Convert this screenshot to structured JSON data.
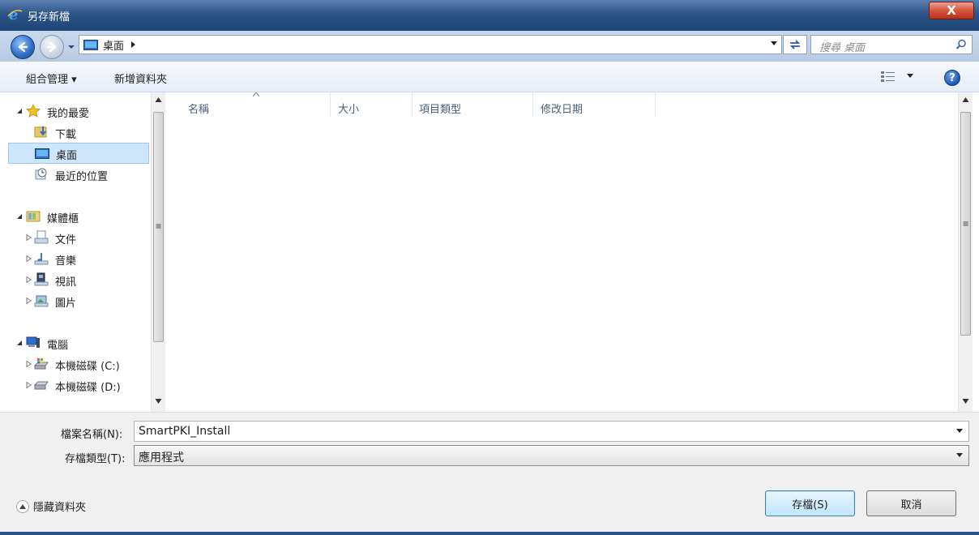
{
  "window": {
    "title": "另存新檔",
    "close_glyph": "X"
  },
  "address": {
    "crumb": "桌面",
    "search_placeholder": "搜尋 桌面"
  },
  "commands": {
    "organize": "組合管理 ▾",
    "new_folder": "新增資料夾",
    "help": "?"
  },
  "nav": {
    "favorites": "我的最愛",
    "downloads": "下載",
    "desktop": "桌面",
    "recent": "最近的位置",
    "libraries": "媒體櫃",
    "documents": "文件",
    "music": "音樂",
    "videos": "視訊",
    "pictures": "圖片",
    "computer": "電腦",
    "drive_c": "本機磁碟 (C:)",
    "drive_d": "本機磁碟 (D:)"
  },
  "columns": {
    "name": "名稱",
    "size": "大小",
    "type": "項目類型",
    "modified": "修改日期"
  },
  "form": {
    "filename_label": "檔案名稱(N):",
    "filename_value": "SmartPKI_Install",
    "filetype_label": "存檔類型(T):",
    "filetype_value": "應用程式",
    "hide_folders": "隱藏資料夾",
    "save": "存檔(S)",
    "cancel": "取消"
  },
  "colors": {
    "selection": "#cde6fb",
    "titlebar": "#2d5489",
    "close": "#c8412a"
  }
}
